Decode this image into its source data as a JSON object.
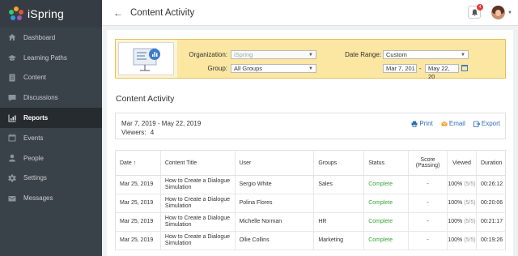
{
  "app": {
    "name": "iSpring"
  },
  "sidebar": {
    "items": [
      {
        "label": "Dashboard",
        "icon": "home-icon"
      },
      {
        "label": "Learning Paths",
        "icon": "graduation-cap-icon"
      },
      {
        "label": "Content",
        "icon": "document-icon"
      },
      {
        "label": "Discussions",
        "icon": "chat-icon"
      },
      {
        "label": "Reports",
        "icon": "bar-chart-icon",
        "active": true
      },
      {
        "label": "Events",
        "icon": "calendar-icon"
      },
      {
        "label": "People",
        "icon": "person-icon"
      },
      {
        "label": "Settings",
        "icon": "gear-icon"
      },
      {
        "label": "Messages",
        "icon": "envelope-icon"
      }
    ]
  },
  "header": {
    "title": "Content Activity",
    "notifications": "4"
  },
  "filters": {
    "organization_label": "Organization:",
    "organization_value": "iSpring",
    "group_label": "Group:",
    "group_value": "All Groups",
    "date_range_label": "Date Range:",
    "date_range_value": "Custom",
    "date_from": "Mar 7, 201",
    "date_to": "May 22, 20",
    "date_separator": "-"
  },
  "main": {
    "section_title": "Content Activity",
    "summary": {
      "range": "Mar 7, 2019 - May 22, 2019",
      "viewers_label": "Viewers:",
      "viewers_count": "4"
    },
    "actions": {
      "print": "Print",
      "email": "Email",
      "export": "Export"
    }
  },
  "table": {
    "headers": {
      "date": "Date ↑",
      "title": "Content Title",
      "user": "User",
      "groups": "Groups",
      "status": "Status",
      "score_line1": "Score",
      "score_line2": "(Passing)",
      "viewed": "Viewed",
      "duration": "Duration"
    },
    "rows": [
      {
        "date": "Mar 25, 2019",
        "title1": "How to Create a Dialogue",
        "title2": "Simulation",
        "user": "Sergio White",
        "groups": "Sales",
        "status": "Complete",
        "score": "-",
        "viewed": "100%",
        "viewed_detail": "(5/5)",
        "duration": "00:26:12"
      },
      {
        "date": "Mar 25, 2019",
        "title1": "How to Create a Dialogue",
        "title2": "Simulation",
        "user": "Polina Flores",
        "groups": "",
        "status": "Complete",
        "score": "-",
        "viewed": "100%",
        "viewed_detail": "(5/5)",
        "duration": "00:20:06"
      },
      {
        "date": "Mar 25, 2019",
        "title1": "How to Create a Dialogue",
        "title2": "Simulation",
        "user": "Michelle Norman",
        "groups": "HR",
        "status": "Complete",
        "score": "-",
        "viewed": "100%",
        "viewed_detail": "(5/5)",
        "duration": "00:21:17"
      },
      {
        "date": "Mar 25, 2019",
        "title1": "How to Create a Dialogue",
        "title2": "Simulation",
        "user": "Ollie Collins",
        "groups": "Marketing",
        "status": "Complete",
        "score": "-",
        "viewed": "100%",
        "viewed_detail": "(5/5)",
        "duration": "00:19:26"
      }
    ]
  },
  "colors": {
    "sidebar": "#3a4249",
    "active": "#262b30",
    "filter_bg": "#fbe6a2",
    "link": "#2f6fb5",
    "complete": "#3aa53a"
  }
}
